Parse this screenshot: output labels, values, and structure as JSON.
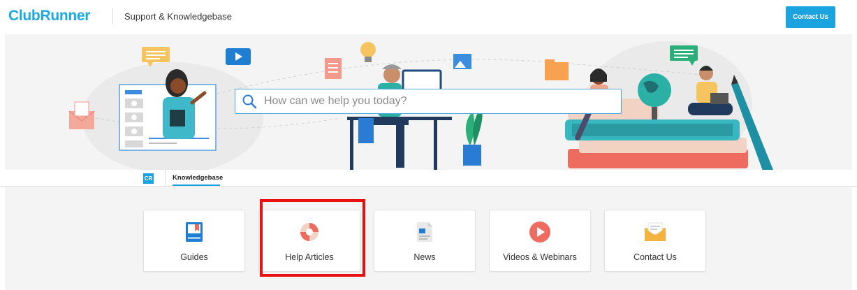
{
  "header": {
    "logo_text": "ClubRunner",
    "site_title": "Support & Knowledgebase",
    "contact_button": "Contact Us"
  },
  "search": {
    "placeholder": "How can we help you today?"
  },
  "tabs": {
    "badge": "CR",
    "items": [
      {
        "label": "Knowledgebase",
        "active": true
      }
    ]
  },
  "categories": [
    {
      "label": "Guides",
      "icon": "book-icon"
    },
    {
      "label": "Help Articles",
      "icon": "lifebuoy-icon"
    },
    {
      "label": "News",
      "icon": "newspaper-icon"
    },
    {
      "label": "Videos & Webinars",
      "icon": "play-icon"
    },
    {
      "label": "Contact Us",
      "icon": "envelope-icon"
    }
  ],
  "colors": {
    "brand": "#1ba9e1",
    "button": "#1aa3df",
    "highlight": "#e81010",
    "hero_background": "#f4f4f4"
  }
}
